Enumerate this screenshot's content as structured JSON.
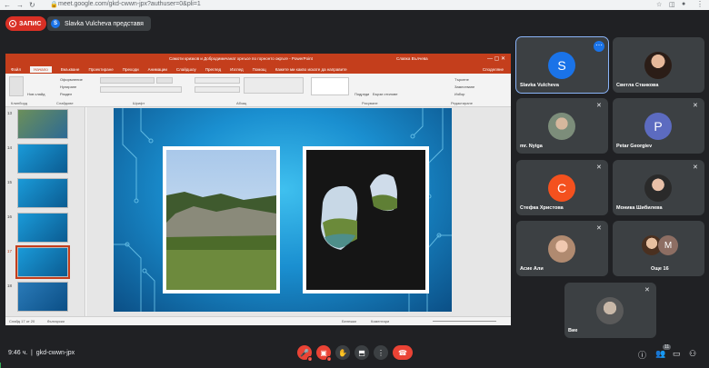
{
  "browser": {
    "url": "meet.google.com/gkd-cwwn-jpx?authuser=0&pli=1"
  },
  "meeting": {
    "recording_label": "ЗАПИС",
    "presenter_initial": "S",
    "presenter_label": "Slavka Vulcheva представя",
    "time": "9:46 ч.",
    "code": "gkd-cwwn-jpx",
    "participant_count": "11"
  },
  "powerpoint": {
    "title": "Самоти кризков и Добродимичанат хрнъсе по горнонто окръге - PowerPoint",
    "user": "Славка Вълчева",
    "tabs": [
      "Файл",
      "Начало",
      "Вмъкване",
      "Проектиране",
      "Преходи",
      "Анимации",
      "Слайдшоу",
      "Преглед",
      "Изглед",
      "Помощ",
      "Кажете ми какво искате да направите"
    ],
    "active_tab": "Начало",
    "share_label": "Споделяне",
    "groups": [
      "Клипборд",
      "Слайдове",
      "Шрифт",
      "Абзац",
      "Рисуване",
      "Редактиране"
    ],
    "ribbon_buttons": {
      "new_slide": "Нов слайд",
      "layout": "Оформление",
      "reset": "Нулиране",
      "section": "Раздел",
      "arrange": "Подреди",
      "quick_styles": "Бързи стилове",
      "find": "Търсене",
      "replace": "Заместване",
      "select": "Избор"
    },
    "thumb_numbers": [
      "13",
      "14",
      "15",
      "16",
      "17",
      "18"
    ],
    "selected_thumb": "17",
    "status_left": "Слайд 17 от 20",
    "status_lang": "български",
    "status_notes": "Бележки",
    "status_comments": "Коментари"
  },
  "participants": [
    {
      "name": "Slavka Vulcheva",
      "initial": "S",
      "color": "#1a73e8",
      "type": "letter"
    },
    {
      "name": "Светла Станкова",
      "type": "photo"
    },
    {
      "name": "mr. Nyiga",
      "type": "photo"
    },
    {
      "name": "Petar Georgiev",
      "initial": "P",
      "color": "#5c6bc0",
      "type": "letter"
    },
    {
      "name": "Стефка Христова",
      "initial": "С",
      "color": "#f4511e",
      "type": "letter"
    },
    {
      "name": "Моника Шибилева",
      "type": "photo"
    },
    {
      "name": "Асие Али",
      "type": "photo"
    },
    {
      "name": "Още 16",
      "initial": "M",
      "color": "#8d6e63",
      "type": "group"
    },
    {
      "name": "Вие",
      "type": "photo"
    }
  ],
  "controls": {
    "mic_icon": "mic-off-icon",
    "cam_icon": "camera-off-icon",
    "hand_icon": "raise-hand-icon",
    "present_icon": "present-icon",
    "more_icon": "more-vert-icon",
    "end_icon": "end-call-icon"
  }
}
